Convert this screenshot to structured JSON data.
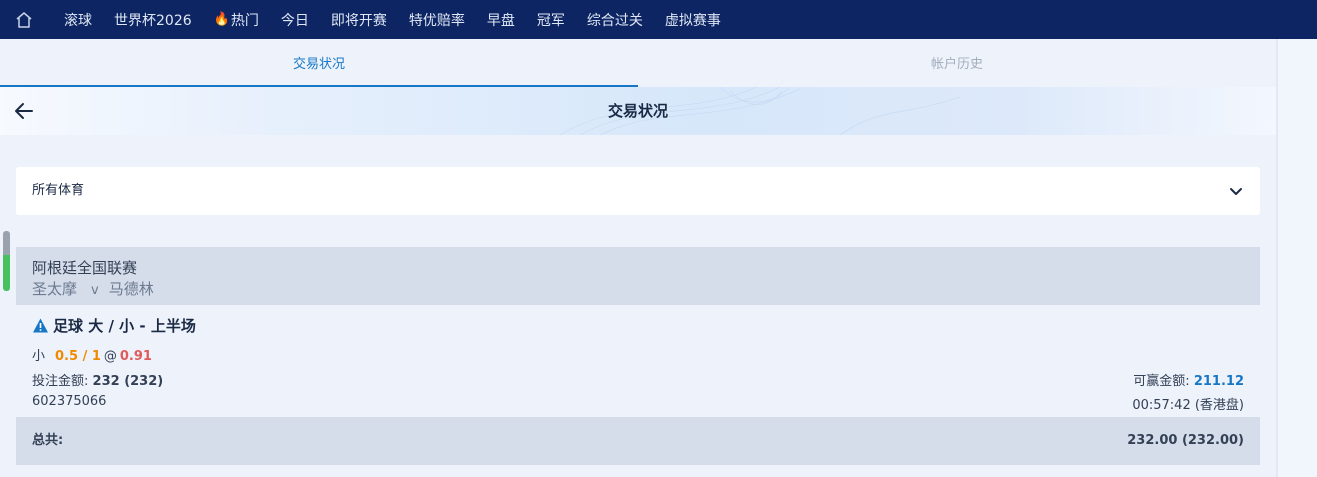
{
  "nav": {
    "items": [
      {
        "label": "滚球"
      },
      {
        "label": "世界杯2026"
      },
      {
        "label": "热门",
        "icon": "fire-icon"
      },
      {
        "label": "今日"
      },
      {
        "label": "即将开赛"
      },
      {
        "label": "特优赔率"
      },
      {
        "label": "早盘"
      },
      {
        "label": "冠军"
      },
      {
        "label": "综合过关"
      },
      {
        "label": "虚拟赛事"
      }
    ]
  },
  "tabs": [
    {
      "label": "交易状况",
      "active": true
    },
    {
      "label": "帐户历史",
      "active": false
    }
  ],
  "header": {
    "title": "交易状况"
  },
  "filter": {
    "selected": "所有体育"
  },
  "bet": {
    "league": "阿根廷全国联赛",
    "home_team": "圣太摩",
    "vs": "v",
    "away_team": "马德林",
    "market": "足球 大 / 小 - 上半场",
    "selection": "小",
    "line": "0.5 / 1",
    "at": "@",
    "odds": "0.91",
    "stake_label": "投注金额:",
    "stake_value": "232 (232)",
    "win_label": "可赢金额:",
    "win_value": "211.12",
    "ticket_id": "602375066",
    "time": "00:57:42 (香港盘)"
  },
  "total": {
    "label": "总共:",
    "value": "232.00 (232.00)"
  },
  "colors": {
    "nav_bg": "#0d2663",
    "accent": "#1677c6",
    "line_orange": "#f08a00",
    "odds_red": "#e05b5b",
    "panel_gray": "#d6ddea"
  }
}
